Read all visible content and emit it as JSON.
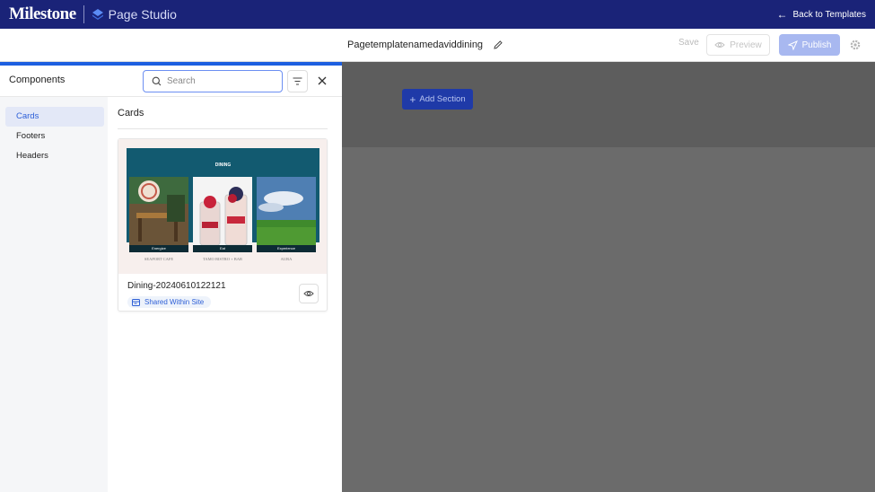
{
  "header": {
    "logo": "Milestone",
    "app_name": "Page Studio",
    "back_label": "Back to Templates"
  },
  "toolbar": {
    "page_title": "Pagetemplatenamedaviddining",
    "save_label": "Save",
    "preview_label": "Preview",
    "publish_label": "Publish"
  },
  "panel": {
    "title": "Components",
    "search_placeholder": "Search",
    "sidebar": [
      {
        "label": "Cards",
        "active": true
      },
      {
        "label": "Footers",
        "active": false
      },
      {
        "label": "Headers",
        "active": false
      }
    ],
    "section_title": "Cards",
    "card": {
      "name": "Dining-20240610122121",
      "badge": "Shared Within Site",
      "thumbnail": {
        "heading": "DINING",
        "tiles": [
          "Energize",
          "Eat",
          "Experience"
        ],
        "venues": [
          "SEAPORT CAFE",
          "TAMO BISTRO + BAR",
          "AURA"
        ]
      }
    }
  },
  "canvas": {
    "add_section_label": "Add Section"
  },
  "colors": {
    "topbar": "#1a2378",
    "accent": "#1d5fe0",
    "publish": "#a8b8f0",
    "add_section": "#1f3aa8"
  }
}
